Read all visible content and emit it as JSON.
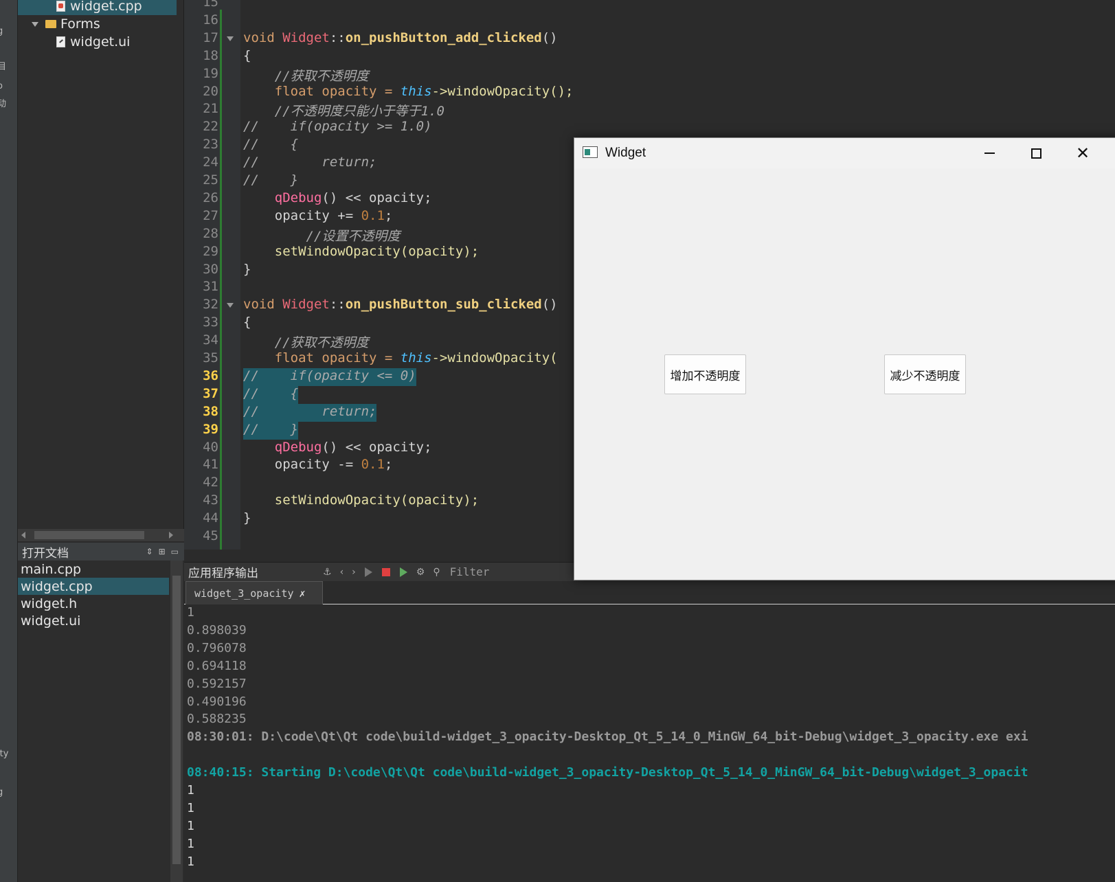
{
  "modebar": {
    "labels": [
      "g",
      "目",
      "o",
      "动",
      "ity",
      "g"
    ]
  },
  "project_tree": {
    "items": [
      {
        "label": "widget.cpp",
        "kind": "cpp",
        "selected": true
      },
      {
        "label": "Forms",
        "kind": "folder",
        "selected": false
      },
      {
        "label": "widget.ui",
        "kind": "ui",
        "selected": false
      }
    ]
  },
  "open_documents": {
    "title": "打开文档",
    "items": [
      {
        "label": "main.cpp",
        "selected": false
      },
      {
        "label": "widget.cpp",
        "selected": true
      },
      {
        "label": "widget.h",
        "selected": false
      },
      {
        "label": "widget.ui",
        "selected": false
      }
    ]
  },
  "editor": {
    "line_numbers": [
      "15",
      "16",
      "17",
      "18",
      "19",
      "20",
      "21",
      "22",
      "23",
      "24",
      "25",
      "26",
      "27",
      "28",
      "29",
      "30",
      "31",
      "32",
      "33",
      "34",
      "35",
      "36",
      "37",
      "38",
      "39",
      "40",
      "41",
      "42",
      "43",
      "44",
      "45"
    ],
    "highlighted_lines": [
      "36",
      "37",
      "38",
      "39"
    ],
    "fold_markers": [
      "17",
      "32"
    ],
    "code": {
      "l17": [
        "void ",
        "Widget",
        "::",
        "on_pushButton_add_clicked",
        "()"
      ],
      "l18": "{",
      "l19": "    //获取不透明度",
      "l20": [
        "    float opacity = ",
        "this",
        "->windowOpacity();"
      ],
      "l21": "    //不透明度只能小于等于1.0",
      "l22": "//    if(opacity >= 1.0)",
      "l23": "//    {",
      "l24": "//        return;",
      "l25": "//    }",
      "l26": [
        "    ",
        "qDebug",
        "() << opacity;"
      ],
      "l27": [
        "    opacity += ",
        "0.1",
        ";"
      ],
      "l28": "        //设置不透明度",
      "l29": "    setWindowOpacity(opacity);",
      "l30": "}",
      "l32": [
        "void ",
        "Widget",
        "::",
        "on_pushButton_sub_clicked",
        "()"
      ],
      "l33": "{",
      "l34": "    //获取不透明度",
      "l35": [
        "    float opacity = ",
        "this",
        "->windowOpacity("
      ],
      "l36": "//    if(opacity <= 0)",
      "l37": "//    {",
      "l38": "//        return;",
      "l39": "//    }",
      "l40": [
        "    ",
        "qDebug",
        "() << opacity;"
      ],
      "l41": [
        "    opacity -= ",
        "0.1",
        ";"
      ],
      "l43": "    setWindowOpacity(opacity);",
      "l44": "}"
    }
  },
  "output": {
    "title": "应用程序输出",
    "filter_placeholder": "Filter",
    "tab_label": "widget_3_opacity",
    "lines": [
      {
        "text": "1",
        "style": "plain"
      },
      {
        "text": "0.898039",
        "style": "plain"
      },
      {
        "text": "0.796078",
        "style": "plain"
      },
      {
        "text": "0.694118",
        "style": "plain"
      },
      {
        "text": "0.592157",
        "style": "plain"
      },
      {
        "text": "0.490196",
        "style": "plain"
      },
      {
        "text": "0.588235",
        "style": "plain"
      },
      {
        "text": "08:30:01: D:\\code\\Qt\\Qt code\\build-widget_3_opacity-Desktop_Qt_5_14_0_MinGW_64_bit-Debug\\widget_3_opacity.exe exi",
        "style": "bold"
      },
      {
        "text": "",
        "style": "plain"
      },
      {
        "text": "08:40:15: Starting D:\\code\\Qt\\Qt code\\build-widget_3_opacity-Desktop_Qt_5_14_0_MinGW_64_bit-Debug\\widget_3_opacit",
        "style": "teal"
      },
      {
        "text": "1",
        "style": "val"
      },
      {
        "text": "1",
        "style": "val"
      },
      {
        "text": "1",
        "style": "val"
      },
      {
        "text": "1",
        "style": "val"
      },
      {
        "text": "1",
        "style": "val"
      }
    ]
  },
  "widget_window": {
    "title": "Widget",
    "add_button": "增加不透明度",
    "sub_button": "减少不透明度"
  }
}
